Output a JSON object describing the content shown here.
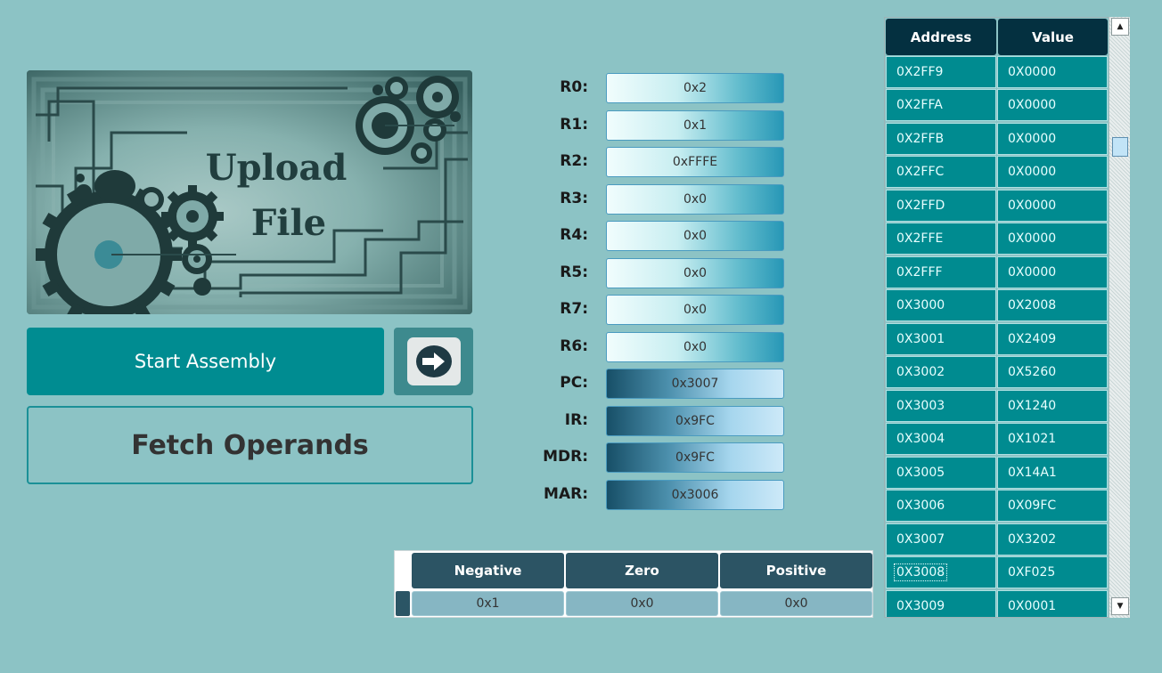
{
  "upload": {
    "line1": "Upload",
    "line2": "File"
  },
  "buttons": {
    "start_assembly": "Start Assembly",
    "fetch_operands": "Fetch Operands",
    "next_icon": "arrow-right-icon"
  },
  "registers": [
    {
      "label": "R0:",
      "value": "0x2"
    },
    {
      "label": "R1:",
      "value": "0x1"
    },
    {
      "label": "R2:",
      "value": "0xFFFE"
    },
    {
      "label": "R3:",
      "value": "0x0"
    },
    {
      "label": "R4:",
      "value": "0x0"
    },
    {
      "label": "R5:",
      "value": "0x0"
    },
    {
      "label": "R7:",
      "value": "0x0"
    },
    {
      "label": "R6:",
      "value": "0x0"
    },
    {
      "label": "PC:",
      "value": "0x3007"
    },
    {
      "label": "IR:",
      "value": "0x9FC"
    },
    {
      "label": "MDR:",
      "value": "0x9FC"
    },
    {
      "label": "MAR:",
      "value": "0x3006"
    }
  ],
  "condition_codes": {
    "headers": [
      "Negative",
      "Zero",
      "Positive"
    ],
    "values": [
      "0x1",
      "0x0",
      "0x0"
    ]
  },
  "memory": {
    "headers": [
      "Address",
      "Value"
    ],
    "selected_address": "0X3008",
    "rows": [
      {
        "address": "0X2FF9",
        "value": "0X0000"
      },
      {
        "address": "0X2FFA",
        "value": "0X0000"
      },
      {
        "address": "0X2FFB",
        "value": "0X0000"
      },
      {
        "address": "0X2FFC",
        "value": "0X0000"
      },
      {
        "address": "0X2FFD",
        "value": "0X0000"
      },
      {
        "address": "0X2FFE",
        "value": "0X0000"
      },
      {
        "address": "0X2FFF",
        "value": "0X0000"
      },
      {
        "address": "0X3000",
        "value": "0X2008"
      },
      {
        "address": "0X3001",
        "value": "0X2409"
      },
      {
        "address": "0X3002",
        "value": "0X5260"
      },
      {
        "address": "0X3003",
        "value": "0X1240"
      },
      {
        "address": "0X3004",
        "value": "0X1021"
      },
      {
        "address": "0X3005",
        "value": "0X14A1"
      },
      {
        "address": "0X3006",
        "value": "0X09FC"
      },
      {
        "address": "0X3007",
        "value": "0X3202"
      },
      {
        "address": "0X3008",
        "value": "0XF025"
      },
      {
        "address": "0X3009",
        "value": "0X0001"
      }
    ]
  },
  "colors": {
    "background": "#8cc3c5",
    "teal_button": "#008c91",
    "memory_cell": "#008b90",
    "memory_header": "#043040",
    "cc_header": "#2c5464"
  }
}
